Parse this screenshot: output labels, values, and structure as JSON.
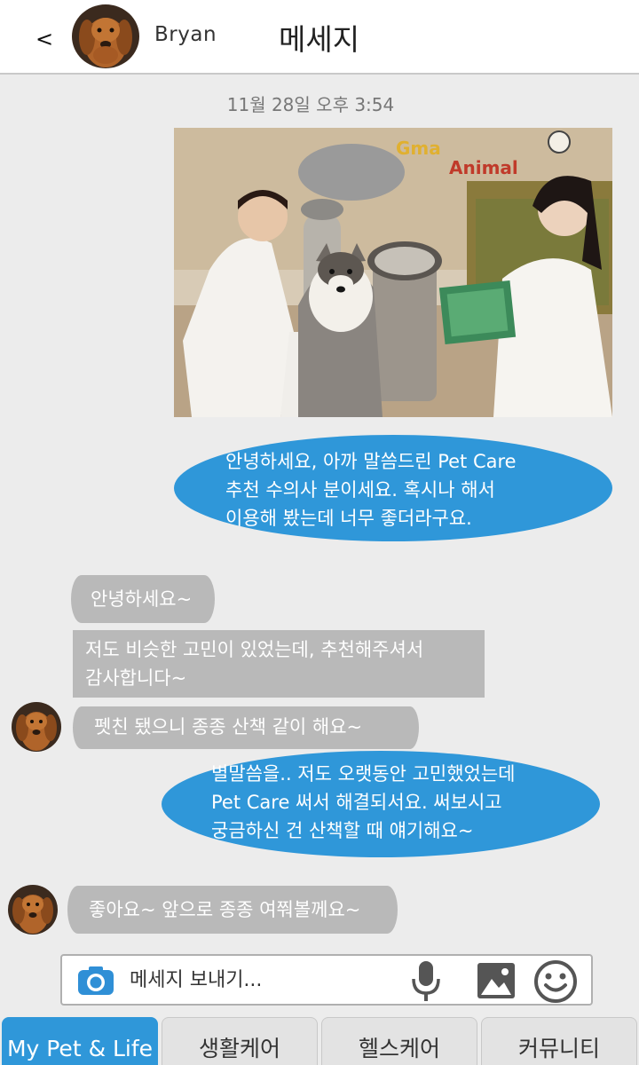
{
  "header": {
    "back_label": "<",
    "contact_name": "Bryan",
    "title": "메세지"
  },
  "timestamp": "11월 28일 오후 3:54",
  "messages": [
    {
      "side": "me",
      "text": "안녕하세요, 아까 말씀드린 Pet Care\n추천 수의사 분이세요. 혹시나 해서\n이용해 봤는데 너무 좋더라구요."
    },
    {
      "side": "them",
      "text": "안녕하세요~"
    },
    {
      "side": "them",
      "text": "저도 비슷한 고민이 있었는데, 추천해주셔서\n감사합니다~"
    },
    {
      "side": "them",
      "text": "펫친 됐으니 종종 산책 같이 해요~"
    },
    {
      "side": "me",
      "text": "별말씀을.. 저도 오랫동안 고민했었는데\nPet Care 써서 해결되서요. 써보시고\n궁금하신 건 산책할 때 얘기해요~"
    },
    {
      "side": "them",
      "text": "좋아요~ 앞으로 종종 여쭤볼께요~"
    }
  ],
  "input": {
    "placeholder": "메세지 보내기..."
  },
  "icons": {
    "camera": "camera-icon",
    "mic": "microphone-icon",
    "image": "image-icon",
    "emoji": "smiley-icon"
  },
  "tabs": [
    {
      "label": "My Pet & Life",
      "active": true
    },
    {
      "label": "생활케어",
      "active": false
    },
    {
      "label": "헬스케어",
      "active": false
    },
    {
      "label": "커뮤니티",
      "active": false
    }
  ],
  "colors": {
    "accent": "#2f97d9",
    "gray_bubble": "#b9b9b9",
    "background": "#ececec"
  }
}
